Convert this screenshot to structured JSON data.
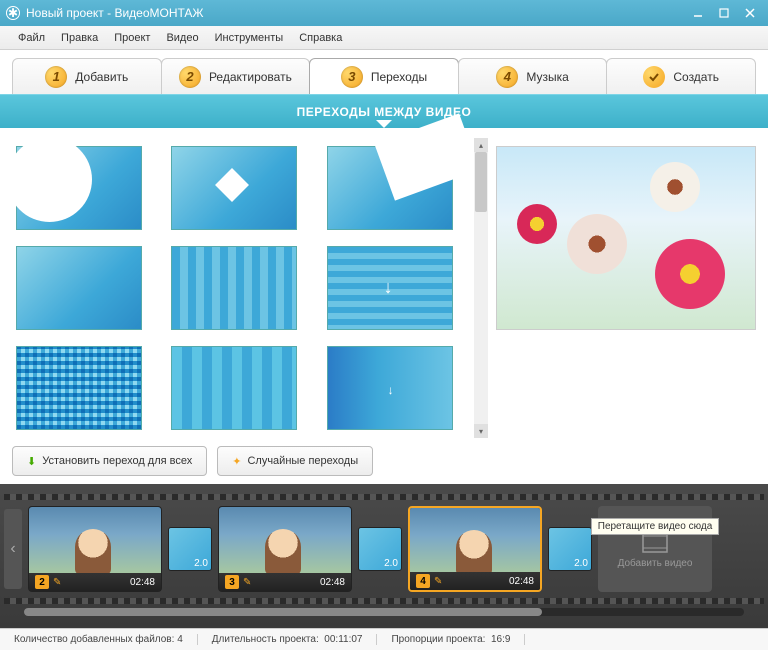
{
  "window": {
    "title": "Новый проект - ВидеоМОНТАЖ"
  },
  "menu": {
    "file": "Файл",
    "edit": "Правка",
    "project": "Проект",
    "video": "Видео",
    "tools": "Инструменты",
    "help": "Справка"
  },
  "steps": {
    "s1": "Добавить",
    "s2": "Редактировать",
    "s3": "Переходы",
    "s4": "Музыка",
    "s5": "Создать"
  },
  "panel": {
    "header": "ПЕРЕХОДЫ МЕЖДУ ВИДЕО"
  },
  "actions": {
    "apply_all": "Установить переход для всех",
    "random": "Случайные переходы"
  },
  "timeline": {
    "clips": [
      {
        "num": "2",
        "time": "02:48"
      },
      {
        "num": "3",
        "time": "02:48"
      },
      {
        "num": "4",
        "time": "02:48"
      }
    ],
    "trans_dur": "2.0",
    "add_label": "Добавить видео",
    "tooltip": "Перетащите видео сюда"
  },
  "status": {
    "files_label": "Количество добавленных файлов:",
    "files_val": "4",
    "dur_label": "Длительность проекта:",
    "dur_val": "00:11:07",
    "aspect_label": "Пропорции проекта:",
    "aspect_val": "16:9"
  }
}
